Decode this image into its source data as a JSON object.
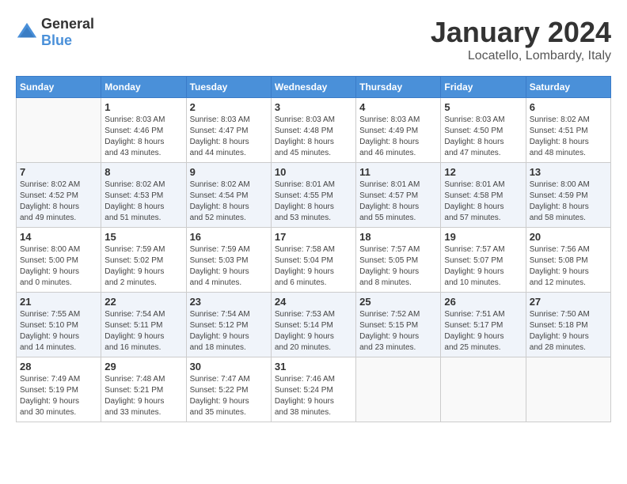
{
  "header": {
    "logo_general": "General",
    "logo_blue": "Blue",
    "month_title": "January 2024",
    "location": "Locatello, Lombardy, Italy"
  },
  "days_of_week": [
    "Sunday",
    "Monday",
    "Tuesday",
    "Wednesday",
    "Thursday",
    "Friday",
    "Saturday"
  ],
  "weeks": [
    {
      "shaded": false,
      "days": [
        {
          "number": "",
          "info": ""
        },
        {
          "number": "1",
          "info": "Sunrise: 8:03 AM\nSunset: 4:46 PM\nDaylight: 8 hours\nand 43 minutes."
        },
        {
          "number": "2",
          "info": "Sunrise: 8:03 AM\nSunset: 4:47 PM\nDaylight: 8 hours\nand 44 minutes."
        },
        {
          "number": "3",
          "info": "Sunrise: 8:03 AM\nSunset: 4:48 PM\nDaylight: 8 hours\nand 45 minutes."
        },
        {
          "number": "4",
          "info": "Sunrise: 8:03 AM\nSunset: 4:49 PM\nDaylight: 8 hours\nand 46 minutes."
        },
        {
          "number": "5",
          "info": "Sunrise: 8:03 AM\nSunset: 4:50 PM\nDaylight: 8 hours\nand 47 minutes."
        },
        {
          "number": "6",
          "info": "Sunrise: 8:02 AM\nSunset: 4:51 PM\nDaylight: 8 hours\nand 48 minutes."
        }
      ]
    },
    {
      "shaded": true,
      "days": [
        {
          "number": "7",
          "info": "Sunrise: 8:02 AM\nSunset: 4:52 PM\nDaylight: 8 hours\nand 49 minutes."
        },
        {
          "number": "8",
          "info": "Sunrise: 8:02 AM\nSunset: 4:53 PM\nDaylight: 8 hours\nand 51 minutes."
        },
        {
          "number": "9",
          "info": "Sunrise: 8:02 AM\nSunset: 4:54 PM\nDaylight: 8 hours\nand 52 minutes."
        },
        {
          "number": "10",
          "info": "Sunrise: 8:01 AM\nSunset: 4:55 PM\nDaylight: 8 hours\nand 53 minutes."
        },
        {
          "number": "11",
          "info": "Sunrise: 8:01 AM\nSunset: 4:57 PM\nDaylight: 8 hours\nand 55 minutes."
        },
        {
          "number": "12",
          "info": "Sunrise: 8:01 AM\nSunset: 4:58 PM\nDaylight: 8 hours\nand 57 minutes."
        },
        {
          "number": "13",
          "info": "Sunrise: 8:00 AM\nSunset: 4:59 PM\nDaylight: 8 hours\nand 58 minutes."
        }
      ]
    },
    {
      "shaded": false,
      "days": [
        {
          "number": "14",
          "info": "Sunrise: 8:00 AM\nSunset: 5:00 PM\nDaylight: 9 hours\nand 0 minutes."
        },
        {
          "number": "15",
          "info": "Sunrise: 7:59 AM\nSunset: 5:02 PM\nDaylight: 9 hours\nand 2 minutes."
        },
        {
          "number": "16",
          "info": "Sunrise: 7:59 AM\nSunset: 5:03 PM\nDaylight: 9 hours\nand 4 minutes."
        },
        {
          "number": "17",
          "info": "Sunrise: 7:58 AM\nSunset: 5:04 PM\nDaylight: 9 hours\nand 6 minutes."
        },
        {
          "number": "18",
          "info": "Sunrise: 7:57 AM\nSunset: 5:05 PM\nDaylight: 9 hours\nand 8 minutes."
        },
        {
          "number": "19",
          "info": "Sunrise: 7:57 AM\nSunset: 5:07 PM\nDaylight: 9 hours\nand 10 minutes."
        },
        {
          "number": "20",
          "info": "Sunrise: 7:56 AM\nSunset: 5:08 PM\nDaylight: 9 hours\nand 12 minutes."
        }
      ]
    },
    {
      "shaded": true,
      "days": [
        {
          "number": "21",
          "info": "Sunrise: 7:55 AM\nSunset: 5:10 PM\nDaylight: 9 hours\nand 14 minutes."
        },
        {
          "number": "22",
          "info": "Sunrise: 7:54 AM\nSunset: 5:11 PM\nDaylight: 9 hours\nand 16 minutes."
        },
        {
          "number": "23",
          "info": "Sunrise: 7:54 AM\nSunset: 5:12 PM\nDaylight: 9 hours\nand 18 minutes."
        },
        {
          "number": "24",
          "info": "Sunrise: 7:53 AM\nSunset: 5:14 PM\nDaylight: 9 hours\nand 20 minutes."
        },
        {
          "number": "25",
          "info": "Sunrise: 7:52 AM\nSunset: 5:15 PM\nDaylight: 9 hours\nand 23 minutes."
        },
        {
          "number": "26",
          "info": "Sunrise: 7:51 AM\nSunset: 5:17 PM\nDaylight: 9 hours\nand 25 minutes."
        },
        {
          "number": "27",
          "info": "Sunrise: 7:50 AM\nSunset: 5:18 PM\nDaylight: 9 hours\nand 28 minutes."
        }
      ]
    },
    {
      "shaded": false,
      "days": [
        {
          "number": "28",
          "info": "Sunrise: 7:49 AM\nSunset: 5:19 PM\nDaylight: 9 hours\nand 30 minutes."
        },
        {
          "number": "29",
          "info": "Sunrise: 7:48 AM\nSunset: 5:21 PM\nDaylight: 9 hours\nand 33 minutes."
        },
        {
          "number": "30",
          "info": "Sunrise: 7:47 AM\nSunset: 5:22 PM\nDaylight: 9 hours\nand 35 minutes."
        },
        {
          "number": "31",
          "info": "Sunrise: 7:46 AM\nSunset: 5:24 PM\nDaylight: 9 hours\nand 38 minutes."
        },
        {
          "number": "",
          "info": ""
        },
        {
          "number": "",
          "info": ""
        },
        {
          "number": "",
          "info": ""
        }
      ]
    }
  ]
}
